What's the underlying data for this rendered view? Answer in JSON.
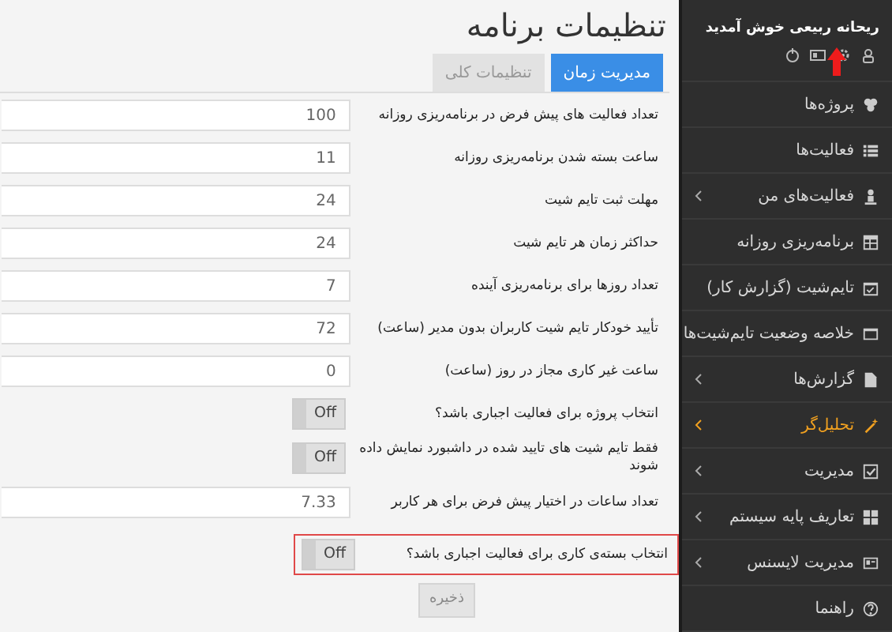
{
  "sidebar": {
    "greeting": "ریحانه ربیعی خوش آمدید",
    "items": [
      {
        "label": "پروژه‌ها",
        "submenu": false,
        "selected": false
      },
      {
        "label": "فعالیت‌ها",
        "submenu": false,
        "selected": false
      },
      {
        "label": "فعالیت‌های من",
        "submenu": true,
        "selected": false
      },
      {
        "label": "برنامه‌ریزی روزانه",
        "submenu": false,
        "selected": false
      },
      {
        "label": "تایم‌شیت (گزارش کار)",
        "submenu": false,
        "selected": false
      },
      {
        "label": "خلاصه وضعیت تایم‌شیت‌ها",
        "submenu": false,
        "selected": false
      },
      {
        "label": "گزارش‌ها",
        "submenu": true,
        "selected": false
      },
      {
        "label": "تحلیل‌گر",
        "submenu": true,
        "selected": true
      },
      {
        "label": "مدیریت",
        "submenu": true,
        "selected": false
      },
      {
        "label": "تعاریف پایه سیستم",
        "submenu": true,
        "selected": false
      },
      {
        "label": "مدیریت لایسنس",
        "submenu": true,
        "selected": false
      },
      {
        "label": "راهنما",
        "submenu": false,
        "selected": false
      }
    ]
  },
  "page": {
    "title": "تنظیمات برنامه",
    "tabs": [
      {
        "label": "مدیریت زمان",
        "selected": true
      },
      {
        "label": "تنظیمات کلی",
        "selected": false
      }
    ],
    "settings": [
      {
        "kind": "number",
        "label": "تعداد فعالیت های پیش فرض در برنامه‌ریزی روزانه",
        "value": "100",
        "highlighted": false
      },
      {
        "kind": "number",
        "label": "ساعت بسته شدن برنامه‌ریزی روزانه",
        "value": "11",
        "highlighted": false
      },
      {
        "kind": "number",
        "label": "مهلت ثبت تایم شیت",
        "value": "24",
        "highlighted": false
      },
      {
        "kind": "number",
        "label": "حداکثر زمان هر تایم شیت",
        "value": "24",
        "highlighted": false
      },
      {
        "kind": "number",
        "label": "تعداد روزها برای برنامه‌ریزی آینده",
        "value": "7",
        "highlighted": false
      },
      {
        "kind": "number",
        "label": "تأیید خودکار تایم شیت کاربران بدون مدیر (ساعت)",
        "value": "72",
        "highlighted": false
      },
      {
        "kind": "number",
        "label": "ساعت غیر کاری مجاز در روز (ساعت)",
        "value": "0",
        "highlighted": false
      },
      {
        "kind": "toggle",
        "label": "انتخاب پروژه برای فعالیت اجباری باشد؟",
        "value": "Off",
        "on": false,
        "highlighted": false
      },
      {
        "kind": "toggle",
        "label": "فقط تایم شیت های تایید شده در داشبورد نمایش داده شوند",
        "value": "Off",
        "on": false,
        "highlighted": false
      },
      {
        "kind": "number",
        "label": "تعداد ساعات در اختیار پیش فرض برای هر کاربر",
        "value": "7.33",
        "highlighted": false
      },
      {
        "kind": "toggle",
        "label": "انتخاب بسته‌ی کاری برای فعالیت اجباری باشد؟",
        "value": "Off",
        "on": false,
        "highlighted": true
      }
    ],
    "save_button": "ذخیره"
  }
}
